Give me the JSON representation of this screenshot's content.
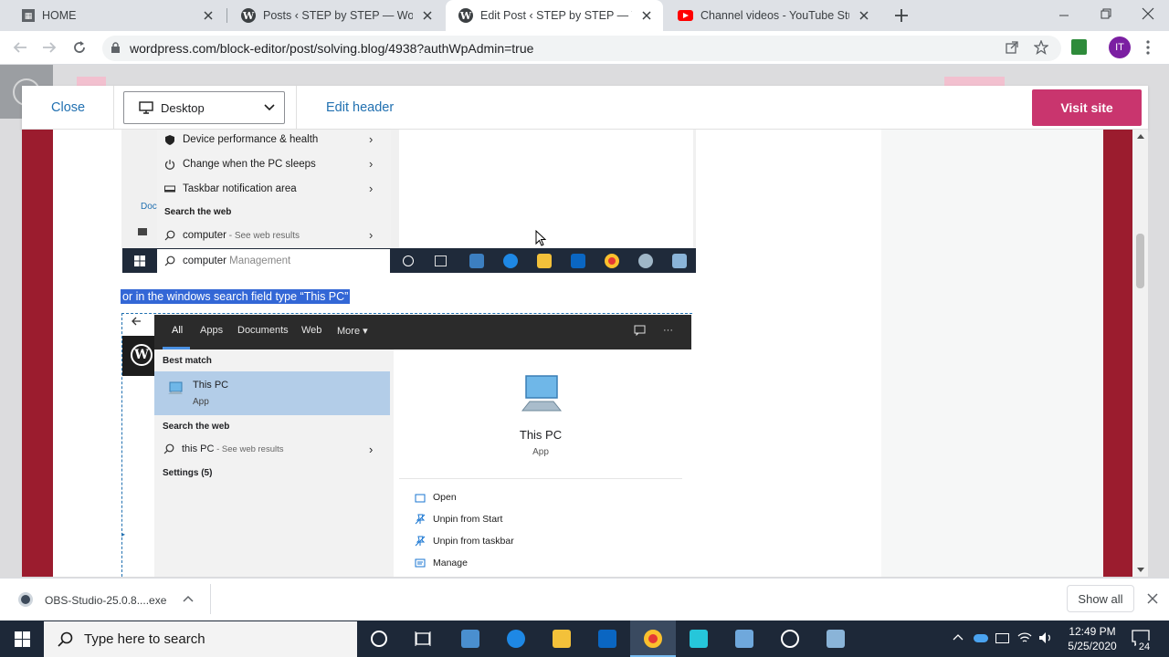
{
  "browser": {
    "tabs": [
      {
        "title": "HOME",
        "icon": "home-favicon"
      },
      {
        "title": "Posts ‹ STEP by STEP — WordPre",
        "icon": "wordpress-favicon"
      },
      {
        "title": "Edit Post ‹ STEP by STEP — Word",
        "icon": "wordpress-favicon",
        "active": true
      },
      {
        "title": "Channel videos - YouTube Studio",
        "icon": "youtube-favicon"
      }
    ],
    "url": "wordpress.com/block-editor/post/solving.blog/4938?authWpAdmin=true",
    "profile_initials": "IT"
  },
  "editor_header": {
    "close_label": "Close",
    "device_label": "Desktop",
    "edit_header_label": "Edit header",
    "visit_site_label": "Visit site"
  },
  "screenshot1": {
    "menu_items": [
      {
        "label": "Device performance & health",
        "icon": "shield-icon"
      },
      {
        "label": "Change when the PC sleeps",
        "icon": "power-icon"
      },
      {
        "label": "Taskbar notification area",
        "icon": "taskbar-icon"
      }
    ],
    "doc_fragment": "Doc",
    "search_web_heading": "Search the web",
    "web_result": {
      "term": "computer",
      "suffix": " - See web results"
    },
    "search_text": "computer",
    "search_suggestion": " Management"
  },
  "highlighted_text": "or in the windows search field type “This PC”",
  "screenshot2": {
    "tabs": [
      "All",
      "Apps",
      "Documents",
      "Web",
      "More"
    ],
    "best_match_heading": "Best match",
    "best_match": {
      "title": "This PC",
      "type": "App"
    },
    "search_web_heading": "Search the web",
    "web_result": {
      "term": "this PC",
      "suffix": " - See web results"
    },
    "settings_label": "Settings (5)",
    "preview": {
      "title": "This PC",
      "type": "App"
    },
    "actions": [
      "Open",
      "Unpin from Start",
      "Unpin from taskbar",
      "Manage"
    ]
  },
  "download_bar": {
    "file_name": "OBS-Studio-25.0.8....exe",
    "show_all_label": "Show all"
  },
  "taskbar": {
    "search_placeholder": "Type here to search",
    "time": "12:49 PM",
    "date": "5/25/2020",
    "notification_count": "24"
  }
}
